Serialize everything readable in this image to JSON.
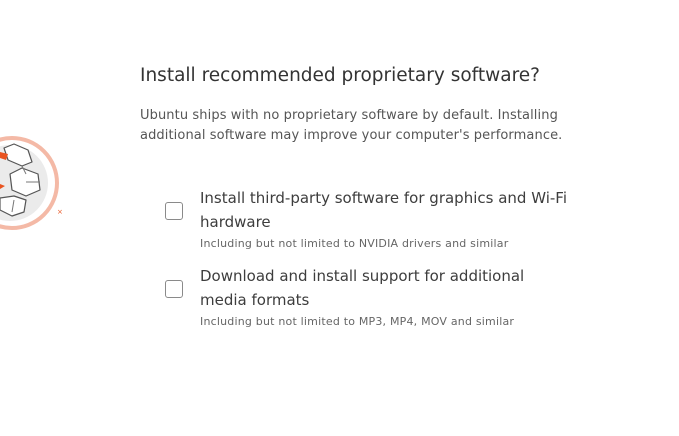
{
  "page": {
    "title": "Install recommended proprietary software?",
    "description": "Ubuntu ships with no proprietary software by default. Installing additional software may improve your computer's performance."
  },
  "options": [
    {
      "label": "Install third-party software for graphics and Wi-Fi hardware",
      "subtitle": "Including but not limited to NVIDIA drivers and similar",
      "checked": false
    },
    {
      "label": "Download and install support for additional media formats",
      "subtitle": "Including but not limited to MP3, MP4, MOV and similar",
      "checked": false
    }
  ],
  "illustration": {
    "icon": "package-boxes-icon",
    "accent_color": "#e95420",
    "ring_color": "#f4b9a6",
    "box_color": "#d9d9d9"
  }
}
